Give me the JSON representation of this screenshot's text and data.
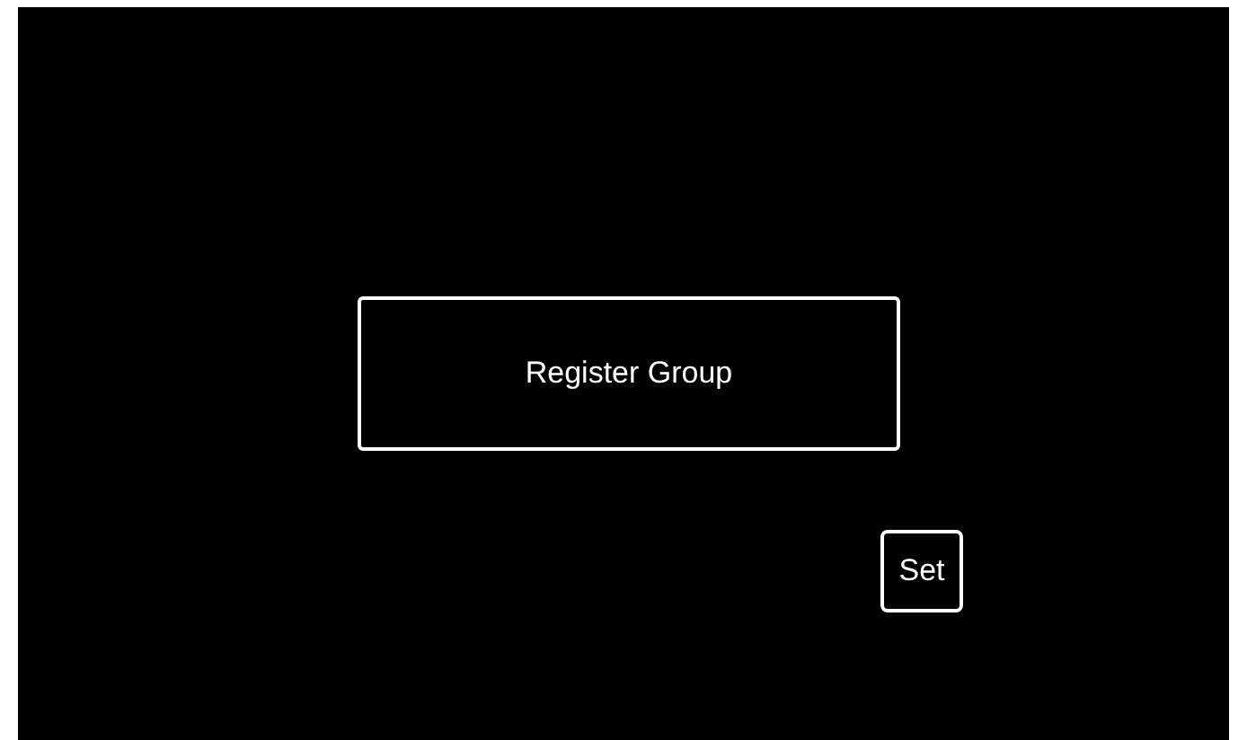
{
  "main_button": {
    "label": "Register Group"
  },
  "set_button": {
    "label": "Set"
  }
}
